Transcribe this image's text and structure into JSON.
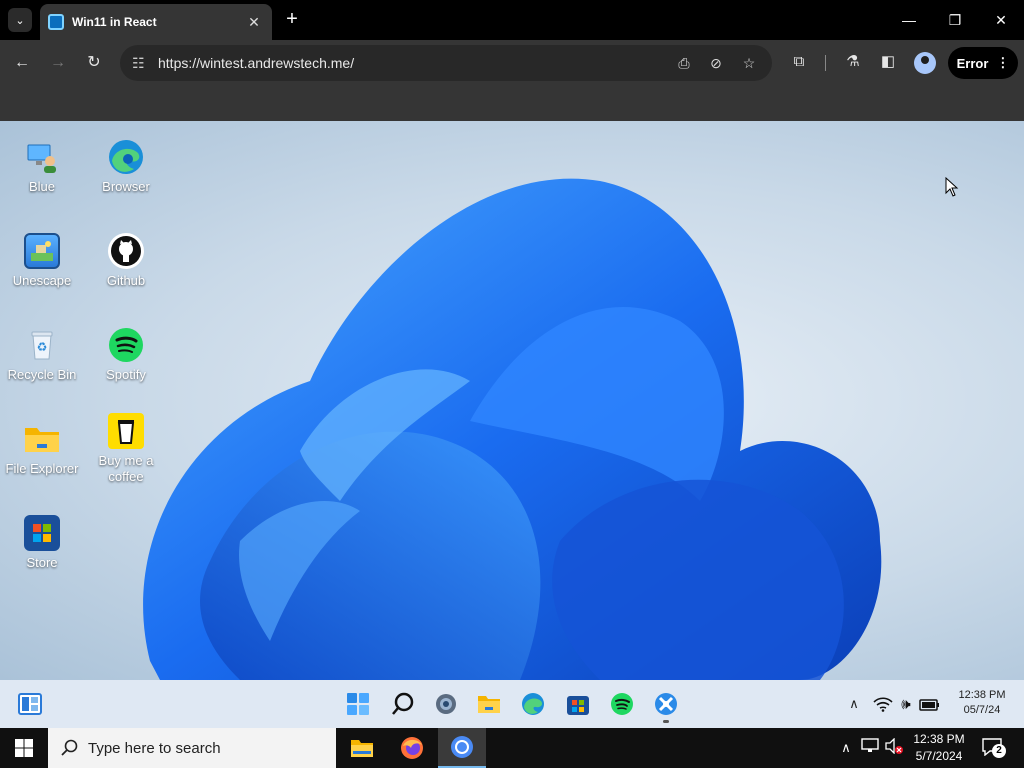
{
  "browser": {
    "tab_title": "Win11 in React",
    "tab_close": "✕",
    "new_tab": "+",
    "url": "https://wintest.andrewstech.me/",
    "error_label": "Error",
    "window_controls": {
      "minimize": "—",
      "maximize": "❐",
      "close": "✕"
    }
  },
  "desktop": {
    "icons": [
      {
        "label": "Blue",
        "icon": "pc-user-icon"
      },
      {
        "label": "Browser",
        "icon": "edge-icon"
      },
      {
        "label": "Unescape",
        "icon": "unescape-icon"
      },
      {
        "label": "Github",
        "icon": "github-icon"
      },
      {
        "label": "Recycle Bin",
        "icon": "recycle-bin-icon"
      },
      {
        "label": "Spotify",
        "icon": "spotify-icon"
      },
      {
        "label": "File Explorer",
        "icon": "folder-icon"
      },
      {
        "label": "Buy me a coffee",
        "icon": "coffee-icon"
      },
      {
        "label": "Store",
        "icon": "store-icon"
      }
    ]
  },
  "win11_taskbar": {
    "apps": [
      "start-icon",
      "search-icon",
      "settings-icon",
      "file-explorer-icon",
      "edge-icon",
      "store-icon",
      "spotify-icon",
      "app-icon"
    ],
    "clock_time": "12:38 PM",
    "clock_date": "05/7/24"
  },
  "host_taskbar": {
    "search_placeholder": "Type here to search",
    "clock_time": "12:38 PM",
    "clock_date": "5/7/2024",
    "notification_count": "2"
  }
}
